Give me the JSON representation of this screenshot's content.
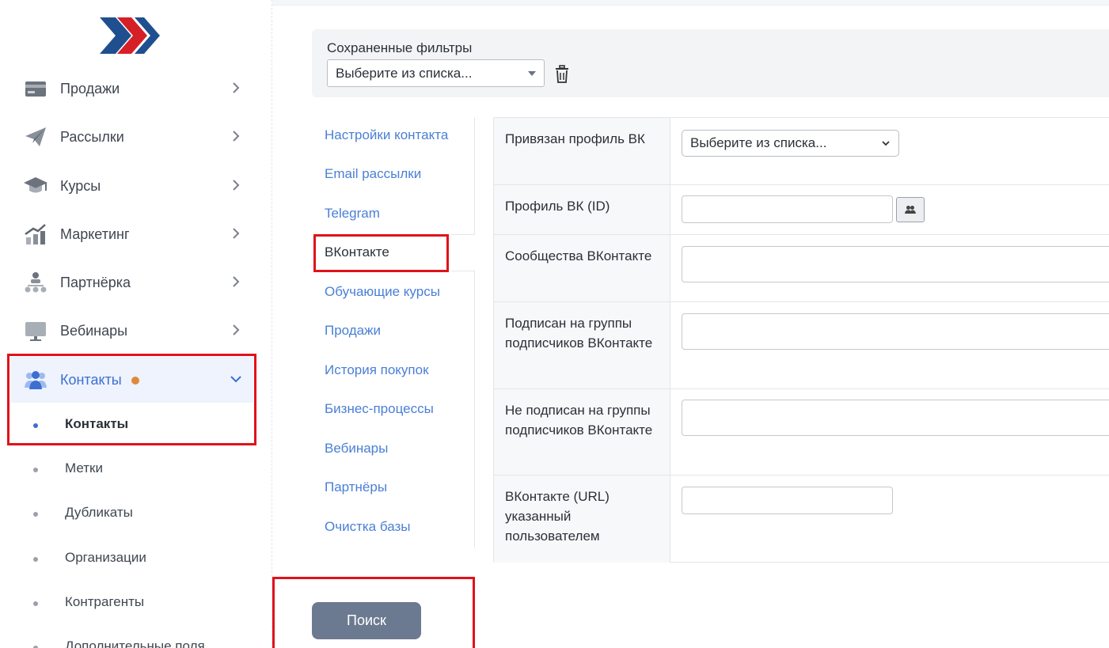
{
  "sidebar": {
    "items": [
      {
        "label": "Продажи",
        "icon": "card-icon"
      },
      {
        "label": "Рассылки",
        "icon": "paper-plane-icon"
      },
      {
        "label": "Курсы",
        "icon": "graduation-cap-icon"
      },
      {
        "label": "Маркетинг",
        "icon": "growth-chart-icon"
      },
      {
        "label": "Партнёрка",
        "icon": "org-tree-icon"
      },
      {
        "label": "Вебинары",
        "icon": "monitor-icon"
      },
      {
        "label": "Контакты",
        "icon": "users-icon"
      }
    ],
    "subitems": [
      "Контакты",
      "Метки",
      "Дубликаты",
      "Организации",
      "Контрагенты",
      "Дополнительные поля"
    ]
  },
  "filters": {
    "title": "Сохраненные фильтры",
    "select_value": "Выберите из списка..."
  },
  "tabs": [
    "Настройки контакта",
    "Email рассылки",
    "Telegram",
    "ВКонтакте",
    "Обучающие курсы",
    "Продажи",
    "История покупок",
    "Бизнес-процессы",
    "Вебинары",
    "Партнёры",
    "Очистка базы"
  ],
  "form": {
    "rows": [
      {
        "label": "Привязан профиль ВК",
        "value": "Выберите из списка..."
      },
      {
        "label": "Профиль ВК (ID)",
        "value": ""
      },
      {
        "label": "Сообщества ВКонтакте",
        "value": ""
      },
      {
        "label": "Подписан на группы подписчиков ВКонтакте",
        "value": ""
      },
      {
        "label": "Не подписан на группы подписчиков ВКонтакте",
        "value": ""
      },
      {
        "label": "ВКонтакте (URL) указанный пользователем",
        "value": ""
      }
    ]
  },
  "search_button": "Поиск",
  "colors": {
    "accent": "#3c6fd2",
    "highlight": "#e0121b",
    "badge": "#e0883c",
    "button": "#6b7a90"
  }
}
